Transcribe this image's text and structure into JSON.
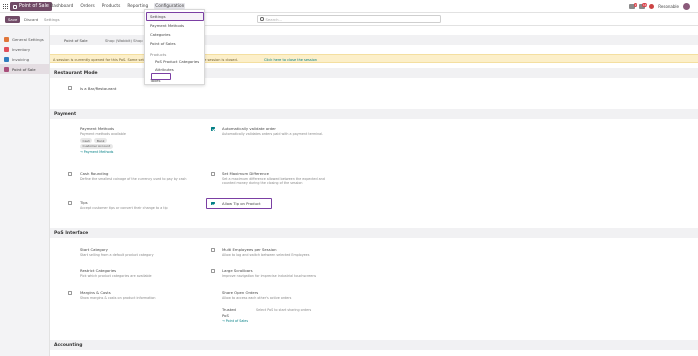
{
  "app": {
    "title": "Point of Sale"
  },
  "nav": {
    "menu": [
      "Dashboard",
      "Orders",
      "Products",
      "Reporting",
      "Configuration"
    ],
    "open_menu_index": 4,
    "search_placeholder": "Search...",
    "messages_count": "2",
    "activities_count": "14",
    "company": "Resonable"
  },
  "control": {
    "save": "Save",
    "discard": "Discard",
    "breadcrumb": "Settings"
  },
  "sidebar": {
    "items": [
      {
        "label": "General Settings",
        "color": "#e0763a"
      },
      {
        "label": "Inventory",
        "color": "#e04f5a"
      },
      {
        "label": "Invoicing",
        "color": "#2f7dbf"
      },
      {
        "label": "Point of Sale",
        "color": "#a94f7b"
      }
    ],
    "active_index": 3
  },
  "pos_bar": {
    "label": "Point of Sale",
    "shop": "Shop (Wabbit) Shop"
  },
  "warning": {
    "text": "A session is currently opened for this PoS. Some settings can only be changed after the session is closed.",
    "link": "Click here to close the session"
  },
  "dropdown": {
    "items": [
      "Settings",
      "Payment Methods",
      "Categories",
      "Point of Sales"
    ],
    "products_header": "Products",
    "products_sub": [
      "PoS Product Categories",
      "Attributes"
    ],
    "taxes": "Taxes"
  },
  "sections": {
    "restaurant": {
      "title": "Restaurant Mode",
      "setting": "Is a Bar/Restaurant"
    },
    "payment": {
      "title": "Payment",
      "methods_title": "Payment Methods",
      "methods_desc": "Payment methods available",
      "methods_tags": [
        "Cash",
        "Bank",
        "Customer Account"
      ],
      "methods_link": "→ Payment Methods",
      "auto_validate_title": "Automatically validate order",
      "auto_validate_desc": "Automatically validates orders paid with a payment terminal.",
      "cash_rounding_title": "Cash Rounding",
      "cash_rounding_desc": "Define the smallest coinage of the currency used to pay by cash",
      "max_diff_title": "Set Maximum Difference",
      "max_diff_desc": "Set a maximum difference allowed between the expected and counted money during the closing of the session",
      "tips_title": "Tips",
      "tips_desc": "Accept customer tips or convert their change to a tip",
      "allow_tip_title": "Allow Tip on Product"
    },
    "pos_interface": {
      "title": "PoS Interface",
      "start_category_title": "Start Category",
      "start_category_desc": "Start selling from a default product category",
      "multi_employees_title": "Multi Employees per Session",
      "multi_employees_desc": "Allow to log and switch between selected Employees",
      "restrict_categories_title": "Restrict Categories",
      "restrict_categories_desc": "Pick which product categories are available",
      "large_scrollbars_title": "Large Scrollbars",
      "large_scrollbars_desc": "Improve navigation for imprecise industrial touchscreens",
      "margins_title": "Margins & Costs",
      "margins_desc": "Show margins & costs on product information",
      "share_orders_title": "Share Open Orders",
      "share_orders_desc": "Allow to access each other's active orders",
      "trusted_label": "Trusted",
      "pos_label": "PoS",
      "trusted_placeholder": "Select PoS to start sharing orders",
      "share_link": "→ Point of Sales"
    },
    "accounting": {
      "title": "Accounting"
    }
  }
}
